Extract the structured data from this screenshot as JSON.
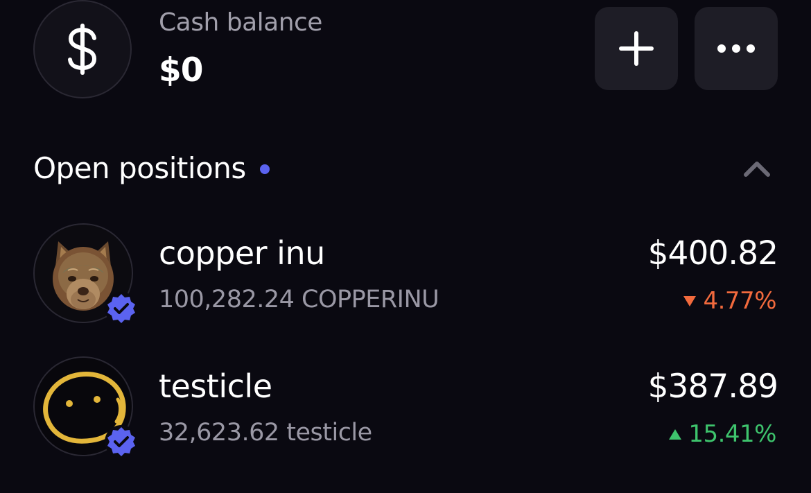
{
  "cash": {
    "icon": "dollar-icon",
    "label": "Cash balance",
    "value": "$0"
  },
  "actions": {
    "add_icon": "plus-icon",
    "more_icon": "more-horizontal-icon"
  },
  "positions": {
    "title": "Open positions",
    "indicator_color": "#5b63f0",
    "collapse_icon": "chevron-up-icon",
    "items": [
      {
        "name": "copper inu",
        "amount": "100,282.24 COPPERINU",
        "value": "$400.82",
        "change": "4.77%",
        "direction": "down",
        "change_color": "#f26a3d",
        "avatar_icon": "copper-dog-avatar",
        "verified": true
      },
      {
        "name": "testicle",
        "amount": "32,623.62 testicle",
        "value": "$387.89",
        "change": "15.41%",
        "direction": "up",
        "change_color": "#3ec46d",
        "avatar_icon": "yellow-face-avatar",
        "verified": true
      }
    ]
  },
  "colors": {
    "background": "#0a0911",
    "button_bg": "#1e1d26",
    "verified_badge": "#5b63f0"
  }
}
